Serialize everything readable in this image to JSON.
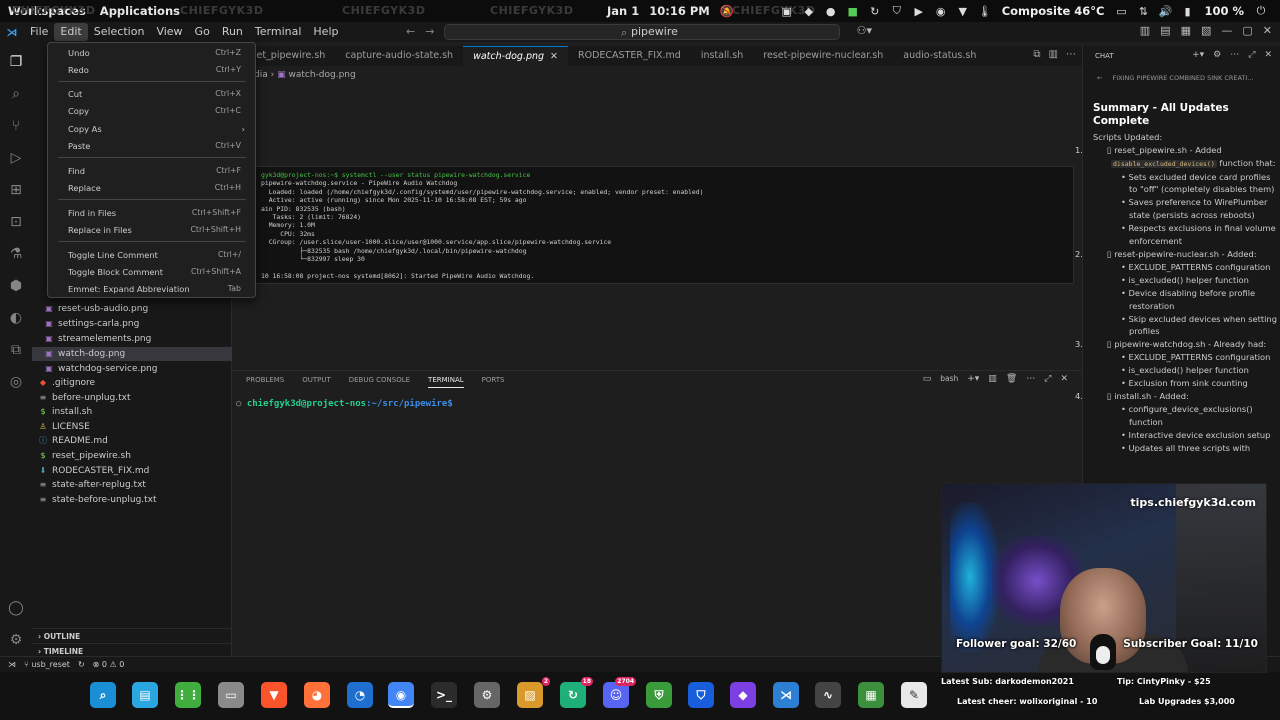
{
  "system_bar": {
    "workspaces": "Workspaces",
    "applications": "Applications",
    "watermarks": [
      "CHIEFGYK3D",
      "CHIEFGYK3D",
      "CHIEFGYK3D",
      "CHIEFGYK3D",
      "CHIEFGYK3D"
    ],
    "date": "Jan 1",
    "time": "10:16 PM",
    "temperature": "Composite 46°C",
    "battery": "100 %"
  },
  "menubar": {
    "items": [
      "File",
      "Edit",
      "Selection",
      "View",
      "Go",
      "Run",
      "Terminal",
      "Help"
    ],
    "search_value": "pipewire"
  },
  "edit_menu": {
    "items": [
      {
        "label": "Undo",
        "shortcut": "Ctrl+Z"
      },
      {
        "label": "Redo",
        "shortcut": "Ctrl+Y"
      },
      {
        "label": "Cut",
        "shortcut": "Ctrl+X"
      },
      {
        "label": "Copy",
        "shortcut": "Ctrl+C"
      },
      {
        "label": "Copy As",
        "shortcut": ""
      },
      {
        "label": "Paste",
        "shortcut": "Ctrl+V"
      },
      {
        "label": "Find",
        "shortcut": "Ctrl+F"
      },
      {
        "label": "Replace",
        "shortcut": "Ctrl+H"
      },
      {
        "label": "Find in Files",
        "shortcut": "Ctrl+Shift+F"
      },
      {
        "label": "Replace in Files",
        "shortcut": "Ctrl+Shift+H"
      },
      {
        "label": "Toggle Line Comment",
        "shortcut": "Ctrl+/"
      },
      {
        "label": "Toggle Block Comment",
        "shortcut": "Ctrl+Shift+A"
      },
      {
        "label": "Emmet: Expand Abbreviation",
        "shortcut": "Tab"
      }
    ]
  },
  "explorer": {
    "files": [
      {
        "name": "reset-usb-audio.png",
        "type": "png"
      },
      {
        "name": "settings-carla.png",
        "type": "png"
      },
      {
        "name": "streamelements.png",
        "type": "png"
      },
      {
        "name": "watch-dog.png",
        "type": "png"
      },
      {
        "name": "watchdog-service.png",
        "type": "png"
      },
      {
        "name": ".gitignore",
        "type": "git"
      },
      {
        "name": "before-unplug.txt",
        "type": "txt"
      },
      {
        "name": "install.sh",
        "type": "sh"
      },
      {
        "name": "LICENSE",
        "type": "license"
      },
      {
        "name": "README.md",
        "type": "md"
      },
      {
        "name": "reset_pipewire.sh",
        "type": "sh"
      },
      {
        "name": "RODECASTER_FIX.md",
        "type": "md"
      },
      {
        "name": "state-after-replug.txt",
        "type": "txt"
      },
      {
        "name": "state-before-unplug.txt",
        "type": "txt"
      }
    ],
    "outline": "OUTLINE",
    "timeline": "TIMELINE"
  },
  "tabs": [
    {
      "label": "reset_pipewire.sh",
      "active": false
    },
    {
      "label": "capture-audio-state.sh",
      "active": false
    },
    {
      "label": "watch-dog.png",
      "active": true
    },
    {
      "label": "RODECASTER_FIX.md",
      "active": false
    },
    {
      "label": "install.sh",
      "active": false
    },
    {
      "label": "reset-pipewire-nuclear.sh",
      "active": false
    },
    {
      "label": "audio-status.sh",
      "active": false
    }
  ],
  "editor": {
    "breadcrumb_dir": "dia",
    "breadcrumb_file": "watch-dog.png",
    "image_lines": [
      "gyk3d@project-nos:~$ systemctl --user status pipewire-watchdog.service",
      "pipewire-watchdog.service - PipeWire Audio Watchdog",
      "  Loaded: loaded (/home/chiefgyk3d/.config/systemd/user/pipewire-watchdog.service; enabled; vendor preset: enabled)",
      "  Active: active (running) since Mon 2025-11-10 16:58:08 EST; 59s ago",
      "ain PID: 832535 (bash)",
      "   Tasks: 2 (limit: 76824)",
      "  Memory: 1.0M",
      "     CPU: 32ms",
      "  CGroup: /user.slice/user-1000.slice/user@1000.service/app.slice/pipewire-watchdog.service",
      "          ├─832535 bash /home/chiefgyk3d/.local/bin/pipewire-watchdog",
      "          └─832997 sleep 30",
      "",
      "10 16:58:08 project-nos systemd[8062]: Started PipeWire Audio Watchdog."
    ]
  },
  "panel": {
    "tabs": [
      "PROBLEMS",
      "OUTPUT",
      "DEBUG CONSOLE",
      "TERMINAL",
      "PORTS"
    ],
    "shell": "bash",
    "prompt_user": "chiefgyk3d@project-nos",
    "prompt_path": ":~/src/pipewire$"
  },
  "chat": {
    "title": "CHAT",
    "subtitle": "FIXING PIPEWIRE COMBINED SINK CREATI...",
    "heading": "Summary - All Updates Complete",
    "intro": "Scripts Updated:",
    "items": [
      {
        "num": "1.",
        "file": "reset_pipewire.sh",
        "text": "- Added",
        "code": "disable_excluded_devices()",
        "tail": "function that:",
        "subs": [
          "Sets excluded device card profiles to \"off\" (completely disables them)",
          "Saves preference to WirePlumber state (persists across reboots)",
          "Respects exclusions in final volume enforcement"
        ]
      },
      {
        "num": "2.",
        "file": "reset-pipewire-nuclear.sh",
        "text": "- Added:",
        "code": "",
        "tail": "",
        "subs": [
          "EXCLUDE_PATTERNS configuration",
          "is_excluded() helper function",
          "Device disabling before profile restoration",
          "Skip excluded devices when setting profiles"
        ]
      },
      {
        "num": "3.",
        "file": "pipewire-watchdog.sh",
        "text": "- Already had:",
        "code": "",
        "tail": "",
        "subs": [
          "EXCLUDE_PATTERNS configuration",
          "is_excluded() helper function",
          "Exclusion from sink counting"
        ]
      },
      {
        "num": "4.",
        "file": "install.sh",
        "text": "- Added:",
        "code": "",
        "tail": "",
        "subs": [
          "configure_device_exclusions() function",
          "Interactive device exclusion setup",
          "Updates all three scripts with"
        ]
      }
    ]
  },
  "statusbar": {
    "branch": "usb_reset",
    "problems": "⊗ 0 ⚠ 0"
  },
  "dock": {
    "badges": {
      "updates": "2",
      "sync": "18",
      "discord": "2704"
    }
  },
  "stream_overlay": {
    "tips": "tips.chiefgyk3d.com",
    "follower_goal": "Follower goal: 32/60",
    "subscriber_goal": "Subscriber Goal: 11/10",
    "latest_sub": "Latest Sub: darkodemon2021",
    "tip": "Tip: CintyPinky - $25",
    "latest_cheer": "Latest cheer: wolixoriginal - 10",
    "lab_upgrades": "Lab Upgrades $3,000"
  }
}
